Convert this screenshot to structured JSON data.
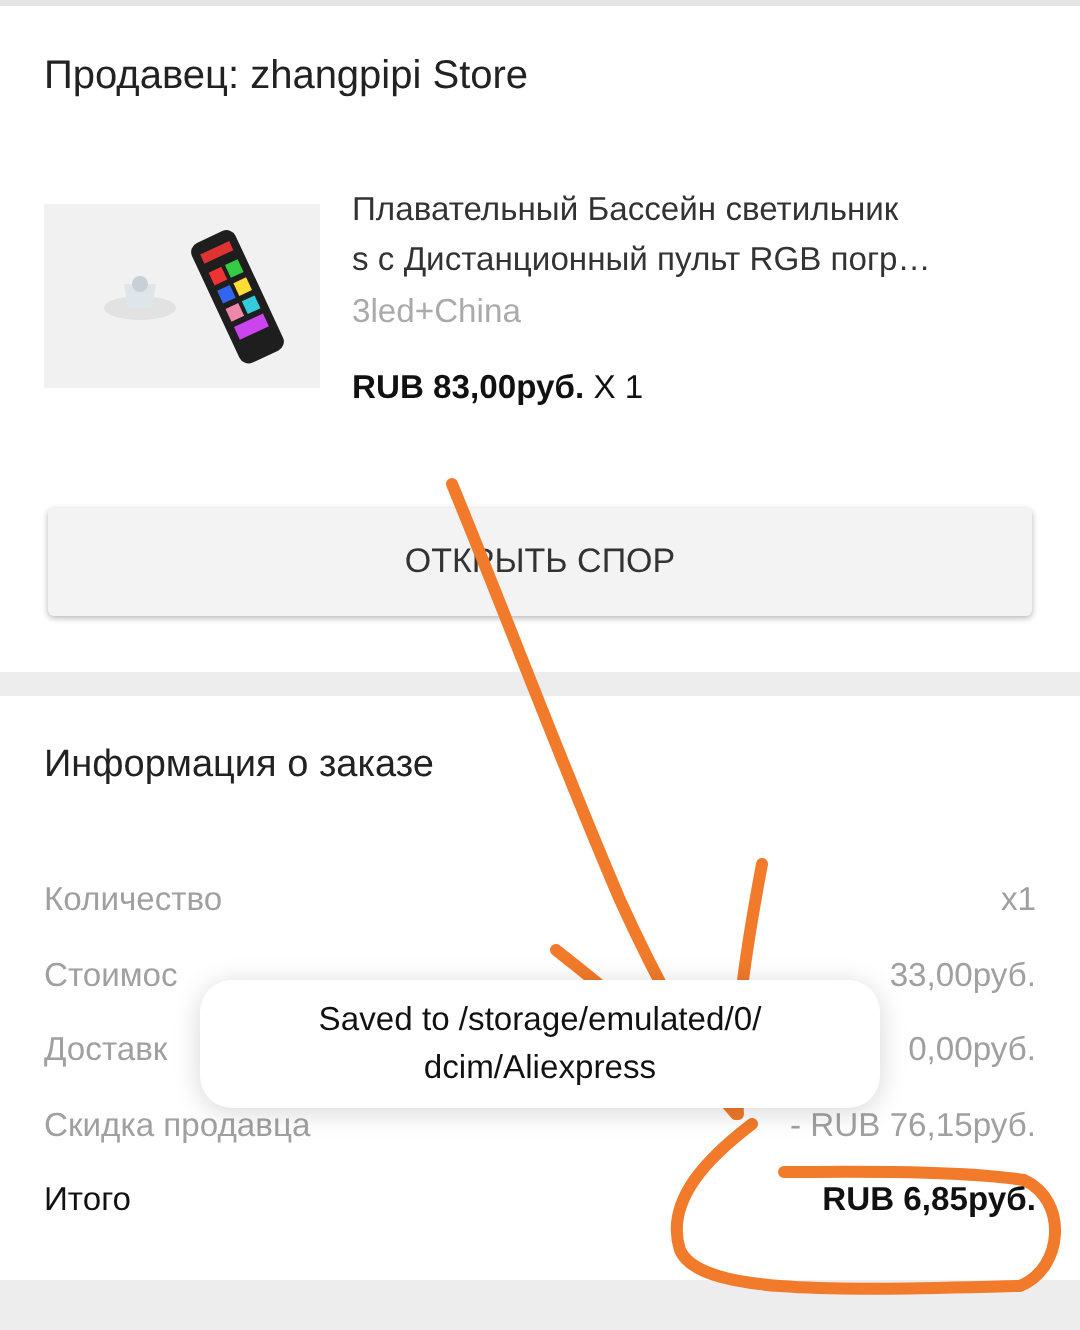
{
  "seller": {
    "label": "Продавец: zhangpipi Store"
  },
  "product": {
    "kind": "picture",
    "title_lines": [
      "Плавательный Бассейн светильник",
      "s с Дистанционный пульт RGB погр…"
    ],
    "variant": "3led+China",
    "price": "**RUB 83,00руб.** X 1"
  },
  "dispute_button": "ОТКРЫТЬ СПОР",
  "order_info": {
    "title": "Информация о заказе",
    "rows": [
      {
        "label": "Количество",
        "value": "x1",
        "kind": "plain"
      },
      {
        "label": "Стоимос",
        "value": "33,00руб.",
        "kind": "plain"
      },
      {
        "label": "Доставк",
        "value": "0,00руб.",
        "kind": "plain"
      },
      {
        "label": "Скидка продавца",
        "value": "- RUB 76,15руб.",
        "kind": "plain"
      },
      {
        "label": "Итого",
        "value": "RUB 6,85руб.",
        "kind": "total"
      }
    ]
  },
  "toast": "Saved to /storage/emulated/0/ dcim/Aliexpress"
}
